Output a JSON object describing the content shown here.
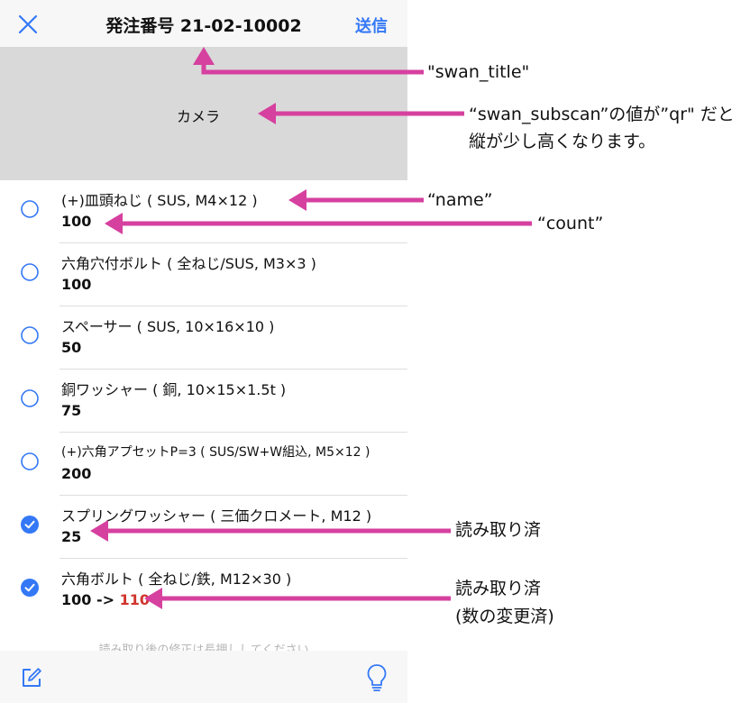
{
  "navbar": {
    "title": "発注番号 21-02-10002",
    "send_label": "送信"
  },
  "camera": {
    "label": "カメラ"
  },
  "items": [
    {
      "name": "(+)皿頭ねじ ( SUS, M4×12 )",
      "count": "100",
      "checked": false
    },
    {
      "name": "六角穴付ボルト ( 全ねじ/SUS, M3×3 )",
      "count": "100",
      "checked": false
    },
    {
      "name": "スペーサー ( SUS, 10×16×10 )",
      "count": "50",
      "checked": false
    },
    {
      "name": "銅ワッシャー ( 銅, 10×15×1.5t )",
      "count": "75",
      "checked": false
    },
    {
      "name": "(+)六角アプセットP=3 ( SUS/SW+W組込, M5×12 )",
      "count": "200",
      "checked": false
    },
    {
      "name": "スプリングワッシャー ( 三価クロメート, M12 )",
      "count": "25",
      "checked": true
    },
    {
      "name": "六角ボルト ( 全ねじ/鉄, M12×30 )",
      "count": "100 -> ",
      "count_new": "110",
      "checked": true
    }
  ],
  "hint": "読み取り後の修正は長押ししてください",
  "annotations": {
    "swan_title": "\"swan_title\"",
    "subscan_line1": "“swan_subscan”の値が”qr\" だと",
    "subscan_line2": "縦が少し高くなります。",
    "name": "“name”",
    "count": "“count”",
    "scanned": "読み取り済",
    "scanned_changed_line1": "読み取り済",
    "scanned_changed_line2": "(数の変更済)"
  },
  "colors": {
    "accent": "#3478f6",
    "arrow": "#d6409f",
    "changed": "#d0342c"
  }
}
